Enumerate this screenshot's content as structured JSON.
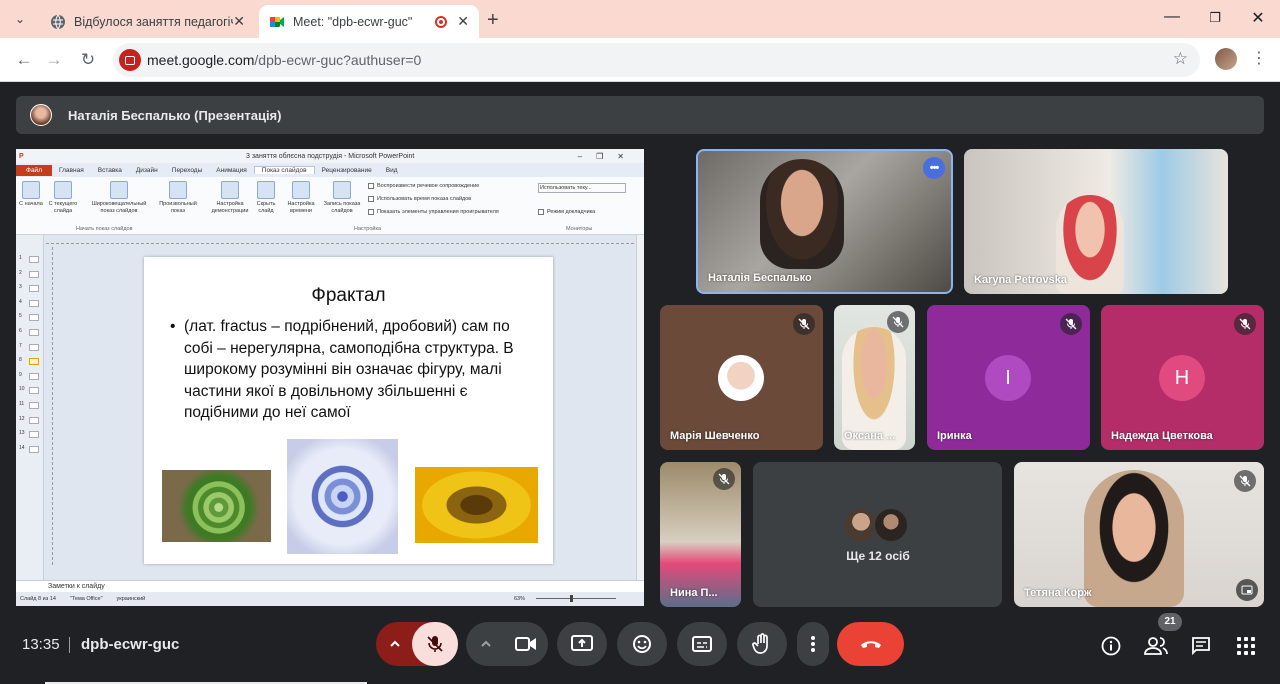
{
  "browser": {
    "tabs": [
      {
        "title": "Відбулося заняття педагогічно"
      },
      {
        "title": "Meet: \"dpb-ecwr-guc\""
      }
    ],
    "url_host": "meet.google.com",
    "url_path": "/dpb-ecwr-guc?authuser=0"
  },
  "presenter": {
    "name": "Наталія Беспалько (Презентація)"
  },
  "ppt": {
    "window_title": "3 заняття облєсна подструдія - Microsoft PowerPoint",
    "ribbon_tabs": [
      "Файл",
      "Главная",
      "Вставка",
      "Дизайн",
      "Переходы",
      "Анимация",
      "Показ слайдов",
      "Рецензирование",
      "Вид"
    ],
    "ribbon_buttons": [
      {
        "label": "С начала"
      },
      {
        "label": "С текущего слайда"
      },
      {
        "label": "Широковещательный показ слайдов"
      },
      {
        "label": "Произвольный показ"
      },
      {
        "label": "Настройка демонстрации"
      },
      {
        "label": "Скрыть слайд"
      },
      {
        "label": "Настройка времени"
      },
      {
        "label": "Запись показа слайдов"
      }
    ],
    "checkboxes": [
      "Воспроизвести речевое сопровождение",
      "Использовать время показа слайдов",
      "Показать элементы управления проигрывателя"
    ],
    "monitor_option": "Использовать теку...",
    "presenter_view": "Режим докладчика",
    "group_labels": [
      "Начать показ слайдов",
      "Настройка",
      "Мониторы"
    ],
    "slide": {
      "title": "Фрактал",
      "text": "(лат. fractus – подрібнений, дробовий) сам по собі – нерегулярна, самоподібна структура. В широкому розумінні він означає фігуру, малі частини якої в довільному збільшенні є подібними до неї самої"
    },
    "notes_placeholder": "Заметки к слайду",
    "status": {
      "slide": "Слайд 8 из 14",
      "theme": "\"Тема Office\"",
      "lang": "украинский",
      "zoom": "63%"
    }
  },
  "participants": [
    {
      "name": "Наталія Беспалько"
    },
    {
      "name": "Karyna Petrovska"
    },
    {
      "name": "Марія Шевченко"
    },
    {
      "name": "Оксана ..."
    },
    {
      "name": "Іринка",
      "initial": "I"
    },
    {
      "name": "Надежда Цветкова",
      "initial": "H"
    },
    {
      "name": "Нина П..."
    },
    {
      "name": "Тетяна Корж"
    }
  ],
  "more_participants": "Ще 12 осіб",
  "meeting": {
    "time": "13:35",
    "code": "dpb-ecwr-guc",
    "participant_count": "21"
  },
  "colors": {
    "accent": "#8ab4f8",
    "end_call": "#ea4335",
    "mic_off": "#f9dedc",
    "irinka": "#8f2a9a",
    "nadezhda": "#b42d68"
  }
}
